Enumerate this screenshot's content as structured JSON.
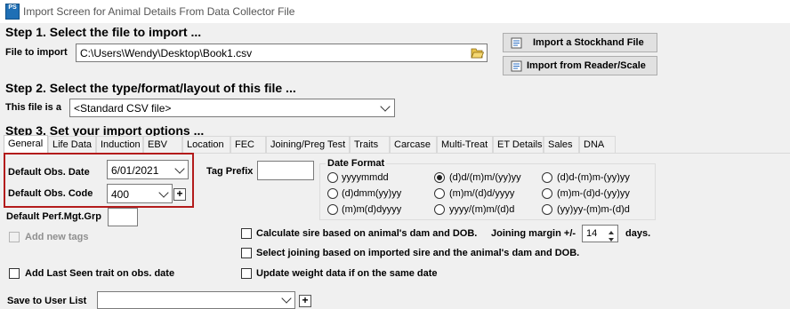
{
  "window": {
    "title": "Import Screen for Animal Details From Data Collector File",
    "app_icon": "PS"
  },
  "step1": {
    "heading": "Step 1.  Select the file to import ...",
    "file_label": "File to import",
    "file_path": "C:\\Users\\Wendy\\Desktop\\Book1.csv",
    "browse_icon": "folder-open-icon",
    "btn_stockhand": "Import a Stockhand File",
    "btn_reader": "Import from Reader/Scale"
  },
  "step2": {
    "heading": "Step 2.  Select the type/format/layout of this file ...",
    "type_label": "This file is a",
    "type_value": "<Standard CSV file>"
  },
  "step3": {
    "heading": "Step 3.  Set your import options ...",
    "tabs": [
      "General",
      "Life Data",
      "Induction",
      "EBV",
      "Location",
      "FEC",
      "Joining/Preg Test",
      "Traits",
      "Carcase",
      "Multi-Treat",
      "ET Details",
      "Sales",
      "DNA"
    ],
    "active_tab": "General"
  },
  "general": {
    "obs_date_label": "Default Obs. Date",
    "obs_date_value": "6/01/2021",
    "obs_code_label": "Default Obs. Code",
    "obs_code_value": "400",
    "perf_label": "Default Perf.Mgt.Grp",
    "perf_value": "",
    "tag_prefix_label": "Tag Prefix",
    "tag_prefix_value": "",
    "add_new_tags": "Add new tags",
    "add_last_seen": "Add Last Seen trait on obs. date",
    "save_user_list_label": "Save to User List",
    "save_user_list_value": "",
    "date_format": {
      "label": "Date Format",
      "options": [
        "yyyymmdd",
        "(d)d/(m)m/(yy)yy",
        "(d)d-(m)m-(yy)yy",
        "(d)dmm(yy)yy",
        "(m)m/(d)d/yyyy",
        "(m)m-(d)d-(yy)yy",
        "(m)m(d)dyyyy",
        "yyyy/(m)m/(d)d",
        "(yy)yy-(m)m-(d)d"
      ],
      "selected": "(d)d/(m)m/(yy)yy"
    },
    "calc_sire": "Calculate sire based on animal's dam and DOB.",
    "joining_margin_label": "Joining margin +/-",
    "joining_margin_value": "14",
    "joining_margin_unit": "days.",
    "select_joining": "Select joining based on imported sire and the animal's dam and DOB.",
    "update_weight": "Update weight data if on the same date"
  }
}
